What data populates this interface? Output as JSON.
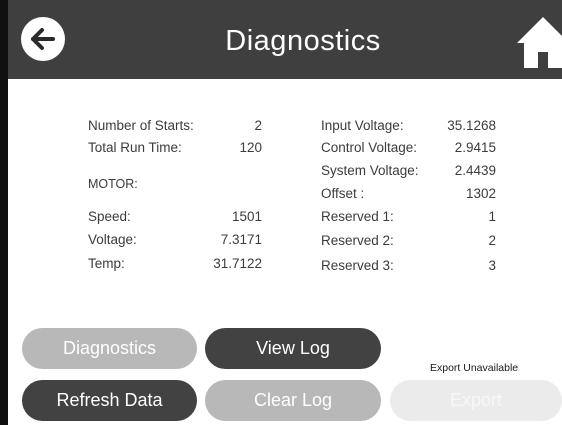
{
  "header": {
    "title": "Diagnostics"
  },
  "stats_left": {
    "number_of_starts_label": "Number of Starts:",
    "number_of_starts_value": "2",
    "total_run_time_label": "Total Run Time:",
    "total_run_time_value": "120",
    "motor_heading": "MOTOR:",
    "speed_label": "Speed:",
    "speed_value": "1501",
    "voltage_label": "Voltage:",
    "voltage_value": "7.3171",
    "temp_label": "Temp:",
    "temp_value": "31.7122"
  },
  "stats_right": {
    "input_voltage_label": "Input Voltage:",
    "input_voltage_value": "35.1268",
    "control_voltage_label": "Control Voltage:",
    "control_voltage_value": "2.9415",
    "system_voltage_label": "System Voltage:",
    "system_voltage_value": "2.4439",
    "offset_label": "Offset :",
    "offset_value": "1302",
    "reserved1_label": "Reserved 1:",
    "reserved1_value": "1",
    "reserved2_label": "Reserved 2:",
    "reserved2_value": "2",
    "reserved3_label": "Reserved 3:",
    "reserved3_value": "3"
  },
  "buttons": {
    "diagnostics": "Diagnostics",
    "view_log": "View Log",
    "refresh_data": "Refresh Data",
    "clear_log": "Clear Log",
    "export": "Export"
  },
  "export_note": "Export Unavailable",
  "icons": {
    "back": "arrow-left-icon",
    "home": "home-icon"
  },
  "colors": {
    "header": "#3f3f3f",
    "button_dark": "#424242",
    "button_light": "#b8b8b8",
    "button_disabled": "#ebebeb"
  }
}
